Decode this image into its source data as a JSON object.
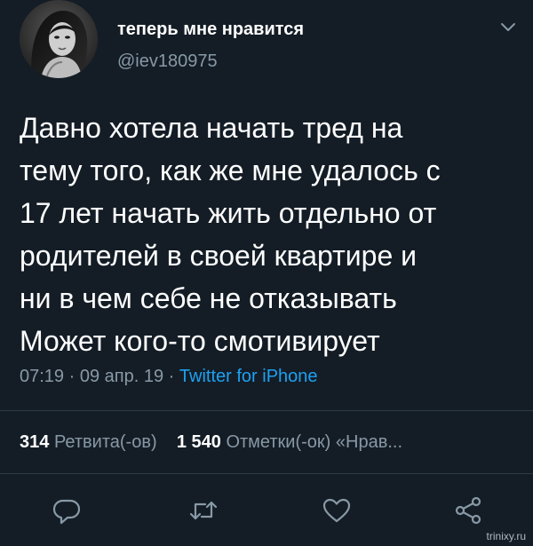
{
  "colors": {
    "background": "#141d26",
    "primary_text": "#ffffff",
    "secondary_text": "#8899a6",
    "link": "#1da1f2",
    "divider": "#2c3a47"
  },
  "tweet": {
    "author": {
      "display_name": "теперь мне нравится",
      "handle": "@iev180975",
      "avatar_icon": "profile-photo"
    },
    "menu_icon": "chevron-down-icon",
    "text_lines": [
      "Давно хотела начать тред на",
      "тему того, как же мне удалось с",
      "17 лет начать жить отдельно от",
      "родителей в своей квартире и",
      "ни в чем себе не отказывать",
      "Может кого-то смотивирует"
    ],
    "time": "07:19",
    "date": "09 апр. 19",
    "separator": "·",
    "source": "Twitter for iPhone",
    "stats": {
      "retweets_count": "314",
      "retweets_label": "Ретвита(-ов)",
      "likes_count": "1 540",
      "likes_label": "Отметки(-ок) «Нрав..."
    },
    "actions": [
      {
        "name": "reply-icon"
      },
      {
        "name": "retweet-icon"
      },
      {
        "name": "like-icon"
      },
      {
        "name": "share-icon"
      }
    ]
  },
  "watermark": "trinixy.ru"
}
